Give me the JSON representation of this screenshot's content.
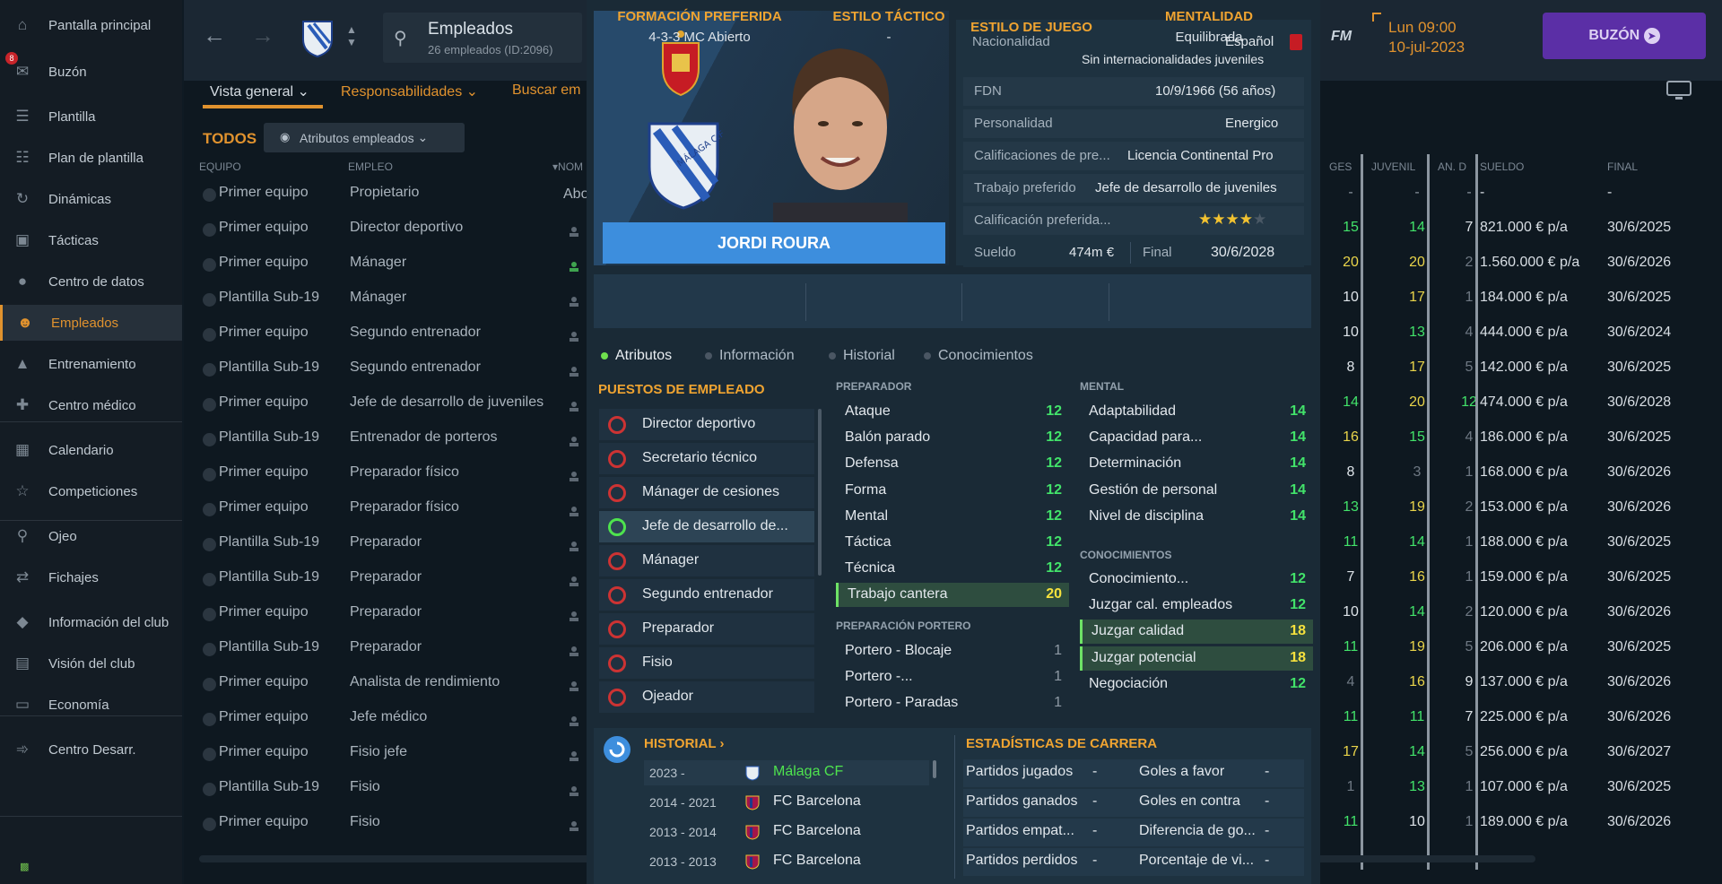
{
  "sidebar": {
    "badge": "8",
    "items": [
      {
        "label": "Pantalla principal",
        "icon": "home-icon"
      },
      {
        "label": "Buzón",
        "icon": "inbox-icon"
      },
      {
        "label": "Plantilla",
        "icon": "shirt-icon"
      },
      {
        "label": "Plan de plantilla",
        "icon": "clipboard-icon"
      },
      {
        "label": "Dinámicas",
        "icon": "dynamics-icon"
      },
      {
        "label": "Tácticas",
        "icon": "tactics-board-icon"
      },
      {
        "label": "Centro de datos",
        "icon": "data-circle-icon"
      },
      {
        "label": "Empleados",
        "icon": "staff-icon"
      },
      {
        "label": "Entrenamiento",
        "icon": "training-cone-icon"
      },
      {
        "label": "Centro médico",
        "icon": "medical-kit-icon"
      },
      {
        "label": "Calendario",
        "icon": "calendar-icon"
      },
      {
        "label": "Competiciones",
        "icon": "trophy-icon"
      },
      {
        "label": "Ojeo",
        "icon": "magnifier-icon"
      },
      {
        "label": "Fichajes",
        "icon": "transfer-arrows-icon"
      },
      {
        "label": "Información del club",
        "icon": "shield-icon"
      },
      {
        "label": "Visión del club",
        "icon": "briefcase-icon"
      },
      {
        "label": "Economía",
        "icon": "money-icon"
      },
      {
        "label": "Centro Desarr.",
        "icon": "development-icon"
      }
    ]
  },
  "header": {
    "title": "Empleados",
    "subtitle": "26 empleados (ID:2096)",
    "tabs": [
      "Vista general",
      "Responsabilidades",
      "Buscar em"
    ],
    "filter_label": "TODOS",
    "view_label": "Atributos empleados",
    "date_line1": "Lun 09:00",
    "date_line2": "10-jul-2023",
    "fm_label": "FM",
    "mail_button": "BUZÓN"
  },
  "table": {
    "col_equipo": "EQUIPO",
    "col_empleo": "EMPLEO",
    "col_nombre": "NOM",
    "col_ges": "GES",
    "col_juvenil": "JUVENIL",
    "col_and": "AN. D",
    "col_sueldo": "SUELDO",
    "col_final": "FINAL",
    "first_row_fragment": "Abo",
    "rows": [
      {
        "equipo": "Primer equipo",
        "empleo": "Propietario",
        "ges": "-",
        "juv": "-",
        "and": "-",
        "sueldo": "-",
        "final": "-"
      },
      {
        "equipo": "Primer equipo",
        "empleo": "Director deportivo",
        "ges": "15",
        "juv": "14",
        "and": "7",
        "sueldo": "821.000 € p/a",
        "final": "30/6/2025"
      },
      {
        "equipo": "Primer equipo",
        "empleo": "Mánager",
        "ges": "20",
        "juv": "20",
        "and": "2",
        "sueldo": "1.560.000 € p/a",
        "final": "30/6/2026"
      },
      {
        "equipo": "Plantilla Sub-19",
        "empleo": "Mánager",
        "ges": "10",
        "juv": "17",
        "and": "1",
        "sueldo": "184.000 € p/a",
        "final": "30/6/2025"
      },
      {
        "equipo": "Primer equipo",
        "empleo": "Segundo entrenador",
        "ges": "10",
        "juv": "13",
        "and": "4",
        "sueldo": "444.000 € p/a",
        "final": "30/6/2024"
      },
      {
        "equipo": "Plantilla Sub-19",
        "empleo": "Segundo entrenador",
        "ges": "8",
        "juv": "17",
        "and": "5",
        "sueldo": "142.000 € p/a",
        "final": "30/6/2025"
      },
      {
        "equipo": "Primer equipo",
        "empleo": "Jefe de desarrollo de juveniles",
        "ges": "14",
        "juv": "20",
        "and": "12",
        "sueldo": "474.000 € p/a",
        "final": "30/6/2028"
      },
      {
        "equipo": "Plantilla Sub-19",
        "empleo": "Entrenador de porteros",
        "ges": "16",
        "juv": "15",
        "and": "4",
        "sueldo": "186.000 € p/a",
        "final": "30/6/2025"
      },
      {
        "equipo": "Primer equipo",
        "empleo": "Preparador físico",
        "ges": "8",
        "juv": "3",
        "and": "1",
        "sueldo": "168.000 € p/a",
        "final": "30/6/2026"
      },
      {
        "equipo": "Primer equipo",
        "empleo": "Preparador físico",
        "ges": "13",
        "juv": "19",
        "and": "2",
        "sueldo": "153.000 € p/a",
        "final": "30/6/2026"
      },
      {
        "equipo": "Plantilla Sub-19",
        "empleo": "Preparador",
        "ges": "11",
        "juv": "14",
        "and": "1",
        "sueldo": "188.000 € p/a",
        "final": "30/6/2025"
      },
      {
        "equipo": "Plantilla Sub-19",
        "empleo": "Preparador",
        "ges": "7",
        "juv": "16",
        "and": "1",
        "sueldo": "159.000 € p/a",
        "final": "30/6/2025"
      },
      {
        "equipo": "Primer equipo",
        "empleo": "Preparador",
        "ges": "10",
        "juv": "14",
        "and": "2",
        "sueldo": "120.000 € p/a",
        "final": "30/6/2026"
      },
      {
        "equipo": "Plantilla Sub-19",
        "empleo": "Preparador",
        "ges": "11",
        "juv": "19",
        "and": "5",
        "sueldo": "206.000 € p/a",
        "final": "30/6/2025"
      },
      {
        "equipo": "Primer equipo",
        "empleo": "Analista de rendimiento",
        "ges": "4",
        "juv": "16",
        "and": "9",
        "sueldo": "137.000 € p/a",
        "final": "30/6/2026"
      },
      {
        "equipo": "Primer equipo",
        "empleo": "Jefe médico",
        "ges": "11",
        "juv": "11",
        "and": "7",
        "sueldo": "225.000 € p/a",
        "final": "30/6/2026"
      },
      {
        "equipo": "Primer equipo",
        "empleo": "Fisio jefe",
        "ges": "17",
        "juv": "14",
        "and": "5",
        "sueldo": "256.000 € p/a",
        "final": "30/6/2027"
      },
      {
        "equipo": "Plantilla Sub-19",
        "empleo": "Fisio",
        "ges": "1",
        "juv": "13",
        "and": "1",
        "sueldo": "107.000 € p/a",
        "final": "30/6/2025"
      },
      {
        "equipo": "Primer equipo",
        "empleo": "Fisio",
        "ges": "11",
        "juv": "10",
        "and": "1",
        "sueldo": "189.000 € p/a",
        "final": "30/6/2026"
      }
    ]
  },
  "colors": {
    "accent": "#e0922e",
    "green": "#42e36a",
    "yellow": "#f6e13d",
    "name_bar": "#3d8edd",
    "mail_purple": "#5b2fa6"
  },
  "profile": {
    "name": "JORDI ROURA",
    "info": {
      "nacionalidad_k": "Nacionalidad",
      "nacionalidad_v": "Español",
      "nacionalidad_sub": "Sin internacionalidades juveniles",
      "fdn_k": "FDN",
      "fdn_v": "10/9/1966 (56 años)",
      "pers_k": "Personalidad",
      "pers_v": "Energico",
      "calif_k": "Calificaciones de pre...",
      "calif_v": "Licencia Continental Pro",
      "trabajo_k": "Trabajo preferido",
      "trabajo_v": "Jefe de desarrollo de juveniles",
      "calpref_k": "Calificación preferida...",
      "calpref_stars": 4,
      "sueldo_k": "Sueldo",
      "sueldo_v": "474m €",
      "final_k": "Final",
      "final_v": "30/6/2028"
    },
    "style": {
      "formacion_k": "FORMACIÓN PREFERIDA",
      "formacion_v": "4-3-3 MC Abierto",
      "tactico_k": "ESTILO TÁCTICO",
      "tactico_v": "-",
      "juego_k": "ESTILO DE JUEGO",
      "mentalidad_k": "MENTALIDAD",
      "mentalidad_v": "Equilibrada"
    },
    "subtabs": [
      "Atributos",
      "Información",
      "Historial",
      "Conocimientos"
    ],
    "roles_title": "PUESTOS DE EMPLEADO",
    "roles": [
      "Director deportivo",
      "Secretario técnico",
      "Mánager de cesiones",
      "Jefe de desarrollo de...",
      "Mánager",
      "Segundo entrenador",
      "Preparador",
      "Fisio",
      "Ojeador"
    ],
    "selected_role": 3,
    "preparador_title": "PREPARADOR",
    "preparador": [
      {
        "n": "Ataque",
        "v": "12"
      },
      {
        "n": "Balón parado",
        "v": "12"
      },
      {
        "n": "Defensa",
        "v": "12"
      },
      {
        "n": "Forma",
        "v": "12"
      },
      {
        "n": "Mental",
        "v": "12"
      },
      {
        "n": "Táctica",
        "v": "12"
      },
      {
        "n": "Técnica",
        "v": "12"
      },
      {
        "n": "Trabajo cantera",
        "v": "20"
      }
    ],
    "portero_title": "PREPARACIÓN PORTERO",
    "portero": [
      {
        "n": "Portero - Blocaje",
        "v": "1"
      },
      {
        "n": "Portero -...",
        "v": "1"
      },
      {
        "n": "Portero - Paradas",
        "v": "1"
      }
    ],
    "mental_title": "MENTAL",
    "mental": [
      {
        "n": "Adaptabilidad",
        "v": "14"
      },
      {
        "n": "Capacidad para...",
        "v": "14"
      },
      {
        "n": "Determinación",
        "v": "14"
      },
      {
        "n": "Gestión de personal",
        "v": "14"
      },
      {
        "n": "Nivel de disciplina",
        "v": "14"
      }
    ],
    "conoc_title": "CONOCIMIENTOS",
    "conoc": [
      {
        "n": "Conocimiento...",
        "v": "12"
      },
      {
        "n": "Juzgar cal. empleados",
        "v": "12"
      },
      {
        "n": "Juzgar calidad",
        "v": "18"
      },
      {
        "n": "Juzgar potencial",
        "v": "18"
      },
      {
        "n": "Negociación",
        "v": "12"
      }
    ],
    "historial_title": "HISTORIAL",
    "historial": [
      {
        "yr": "2023 -",
        "club": "Málaga CF",
        "color": "#4ee34e"
      },
      {
        "yr": "2014 - 2021",
        "club": "FC Barcelona",
        "color": "#e1e7ec"
      },
      {
        "yr": "2013 - 2014",
        "club": "FC Barcelona",
        "color": "#e1e7ec"
      },
      {
        "yr": "2013 - 2013",
        "club": "FC Barcelona",
        "color": "#e1e7ec"
      }
    ],
    "stats_title": "ESTADÍSTICAS DE CARRERA",
    "stats_left": [
      {
        "n": "Partidos jugados",
        "v": "-"
      },
      {
        "n": "Partidos ganados",
        "v": "-"
      },
      {
        "n": "Partidos empat...",
        "v": "-"
      },
      {
        "n": "Partidos perdidos",
        "v": "-"
      }
    ],
    "stats_right": [
      {
        "n": "Goles a favor",
        "v": "-"
      },
      {
        "n": "Goles en contra",
        "v": "-"
      },
      {
        "n": "Diferencia de go...",
        "v": "-"
      },
      {
        "n": "Porcentaje de vi...",
        "v": "-"
      }
    ]
  }
}
